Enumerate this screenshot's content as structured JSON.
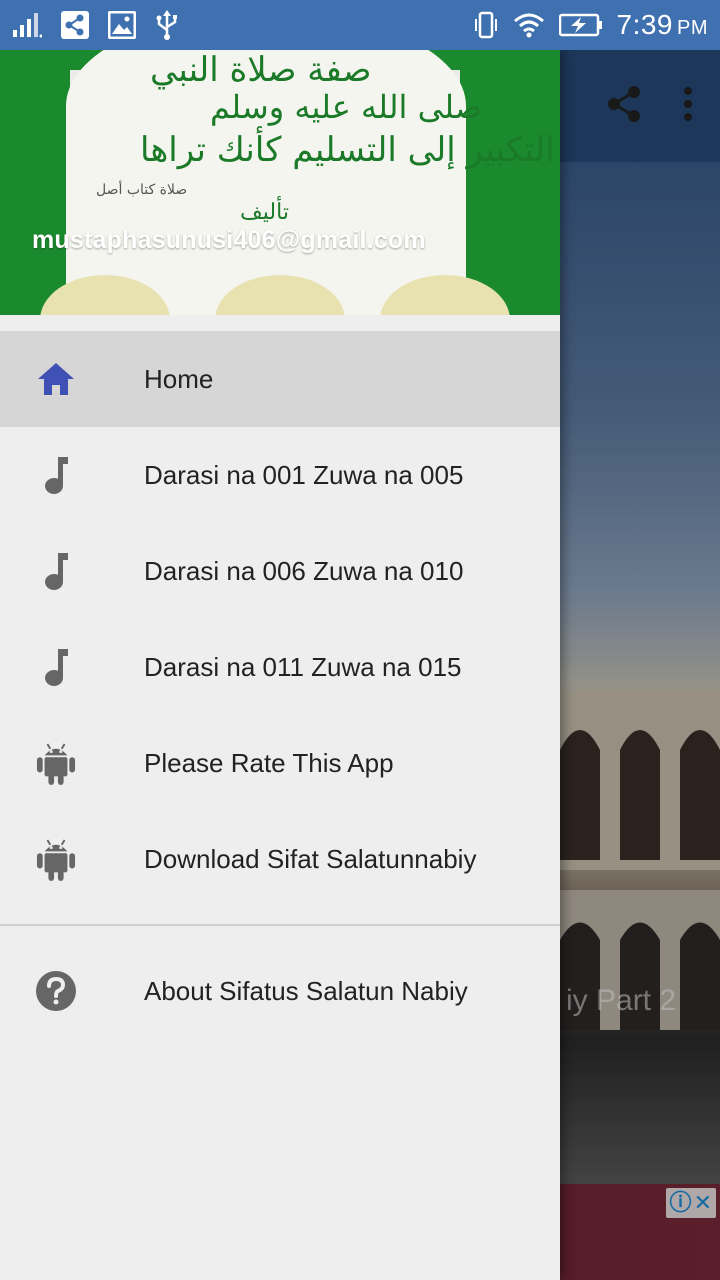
{
  "status_bar": {
    "time": "7:39",
    "ampm": "PM"
  },
  "background": {
    "hero_title_fragment": "iy Part 2"
  },
  "drawer": {
    "header": {
      "email": "mustaphasunusi406@gmail.com",
      "calligraphy_lines": [
        "صفة صلاة النبي",
        "صلى الله عليه وسلم",
        "من التكبير إلى التسليم كأنك تراها",
        "صلاة كتاب أصل",
        "تأليف"
      ]
    },
    "menu_items": [
      {
        "label": "Home",
        "icon": "home-icon",
        "active": true
      },
      {
        "label": "Darasi na 001 Zuwa na 005",
        "icon": "music-note-icon"
      },
      {
        "label": "Darasi na 006 Zuwa na 010",
        "icon": "music-note-icon"
      },
      {
        "label": "Darasi na 011 Zuwa na 015",
        "icon": "music-note-icon"
      },
      {
        "label": "Please Rate This App",
        "icon": "android-icon"
      },
      {
        "label": "Download Sifat Salatunnabiy",
        "icon": "android-icon"
      }
    ],
    "secondary_items": [
      {
        "label": "About Sifatus Salatun Nabiy",
        "icon": "help-icon"
      }
    ]
  },
  "colors": {
    "status_bar": "#3f71b0",
    "drawer_bg": "#eeeeee",
    "active_item_bg": "#d6d6d6",
    "home_icon": "#3f51b5",
    "menu_icon": "#666666"
  }
}
